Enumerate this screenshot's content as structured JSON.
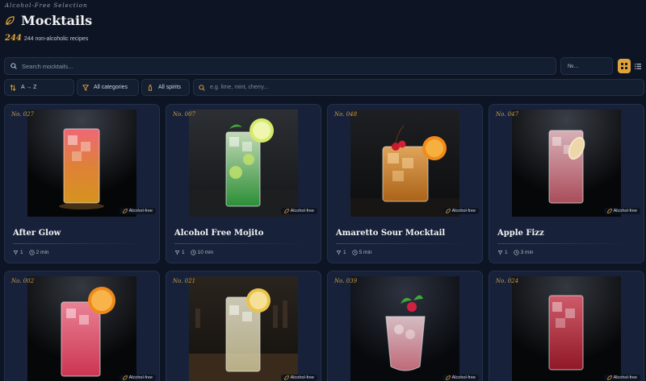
{
  "header": {
    "eyebrow": "Alcohol-Free Selection",
    "title": "Mocktails",
    "count_number": "244",
    "count_text": "244 non-alcoholic recipes"
  },
  "search": {
    "placeholder": "Search mocktails..."
  },
  "number_filter": {
    "placeholder": "№..."
  },
  "filters": {
    "sort_label": "A → Z",
    "categories_label": "All categories",
    "spirits_label": "All spirits",
    "ingredients_placeholder": "e.g. lime, mint, cherry..."
  },
  "colors": {
    "accent": "#e0a43a",
    "background": "#0d1524",
    "card": "#17223a"
  },
  "cards": [
    {
      "number": "No. 027",
      "name": "After Glow",
      "servings": "1",
      "time": "2 min",
      "badge": "Alcohol-free"
    },
    {
      "number": "No. 007",
      "name": "Alcohol Free Mojito",
      "servings": "1",
      "time": "10 min",
      "badge": "Alcohol-free"
    },
    {
      "number": "No. 048",
      "name": "Amaretto Sour Mocktail",
      "servings": "1",
      "time": "5 min",
      "badge": "Alcohol-free"
    },
    {
      "number": "No. 047",
      "name": "Apple Fizz",
      "servings": "1",
      "time": "3 min",
      "badge": "Alcohol-free"
    },
    {
      "number": "No. 002",
      "badge": "Alcohol-free"
    },
    {
      "number": "No. 021",
      "badge": "Alcohol-free"
    },
    {
      "number": "No. 039",
      "badge": "Alcohol-free"
    },
    {
      "number": "No. 024",
      "badge": "Alcohol-free"
    }
  ]
}
